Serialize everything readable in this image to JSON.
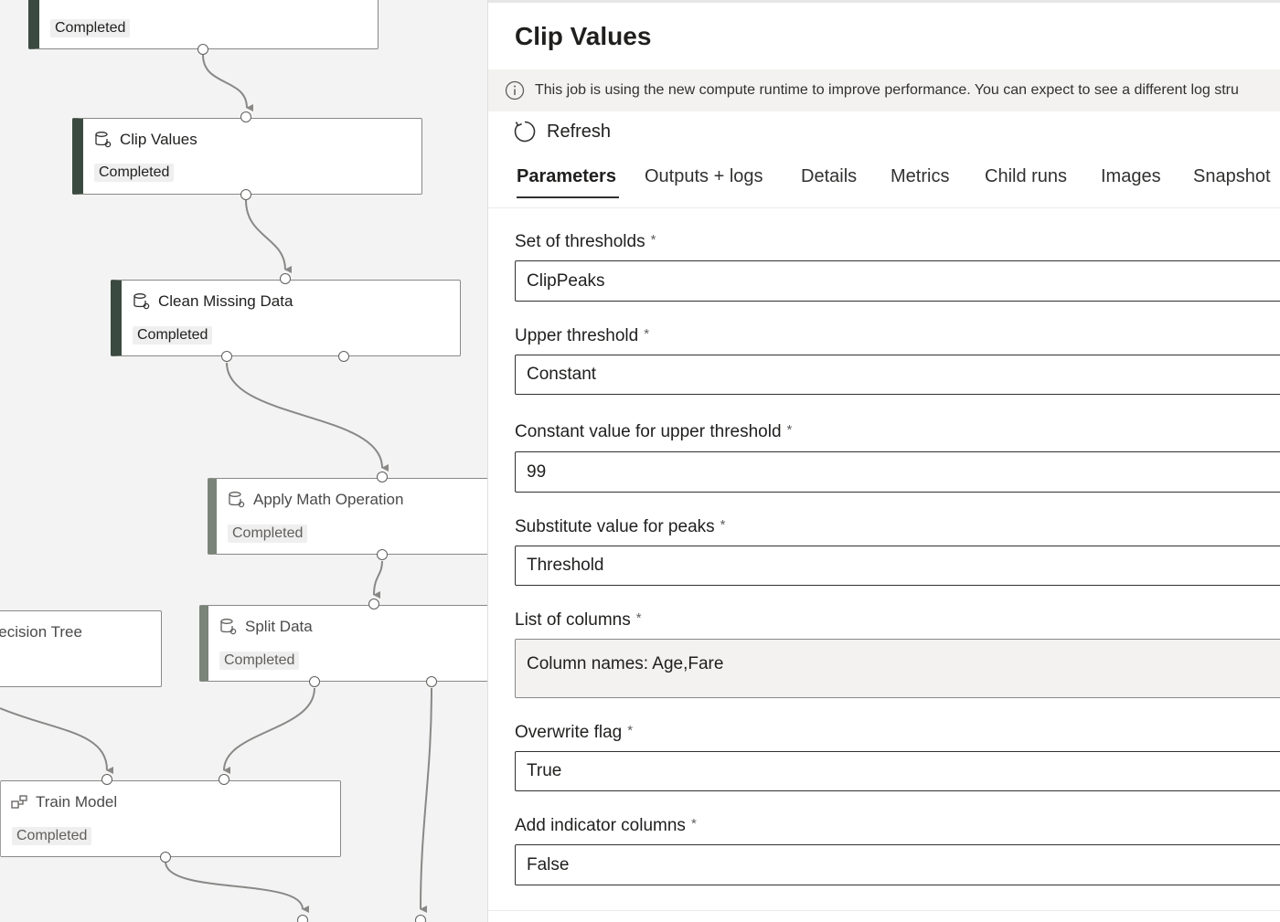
{
  "canvas": {
    "nodes": [
      {
        "id": "top",
        "title": "",
        "status": "Completed"
      },
      {
        "id": "clip",
        "title": "Clip Values",
        "status": "Completed"
      },
      {
        "id": "clean",
        "title": "Clean Missing Data",
        "status": "Completed"
      },
      {
        "id": "math",
        "title": "Apply Math Operation",
        "status": "Completed"
      },
      {
        "id": "dtree",
        "title": "Decision Tree",
        "status": ""
      },
      {
        "id": "split",
        "title": "Split Data",
        "status": "Completed"
      },
      {
        "id": "train",
        "title": "Train Model",
        "status": "Completed"
      }
    ],
    "icons": {
      "dataset": "database-gear-icon",
      "train": "train-model-icon"
    }
  },
  "panel": {
    "title": "Clip Values",
    "banner": {
      "icon": "info-icon",
      "text": "This job is using the new compute runtime to improve performance. You can expect to see a different log stru"
    },
    "refresh": {
      "label": "Refresh",
      "icon": "refresh-icon"
    },
    "tabs": [
      {
        "label": "Parameters",
        "active": true
      },
      {
        "label": "Outputs + logs",
        "active": false
      },
      {
        "label": "Details",
        "active": false
      },
      {
        "label": "Metrics",
        "active": false
      },
      {
        "label": "Child runs",
        "active": false
      },
      {
        "label": "Images",
        "active": false
      },
      {
        "label": "Snapshot",
        "active": false
      }
    ],
    "required_mark": "*",
    "fields": [
      {
        "label": "Set of thresholds",
        "value": "ClipPeaks"
      },
      {
        "label": "Upper threshold",
        "value": "Constant"
      },
      {
        "label": "Constant value for upper threshold",
        "value": "99"
      },
      {
        "label": "Substitute value for peaks",
        "value": "Threshold"
      },
      {
        "label": "List of columns",
        "value": "Column names: Age,Fare"
      },
      {
        "label": "Overwrite flag",
        "value": "True"
      },
      {
        "label": "Add indicator columns",
        "value": "False"
      }
    ]
  },
  "colors": {
    "selected_bar": "#3b4a40",
    "edge": "#8a8886",
    "panel_bg": "#ffffff",
    "canvas_bg": "#f3f3f3"
  }
}
